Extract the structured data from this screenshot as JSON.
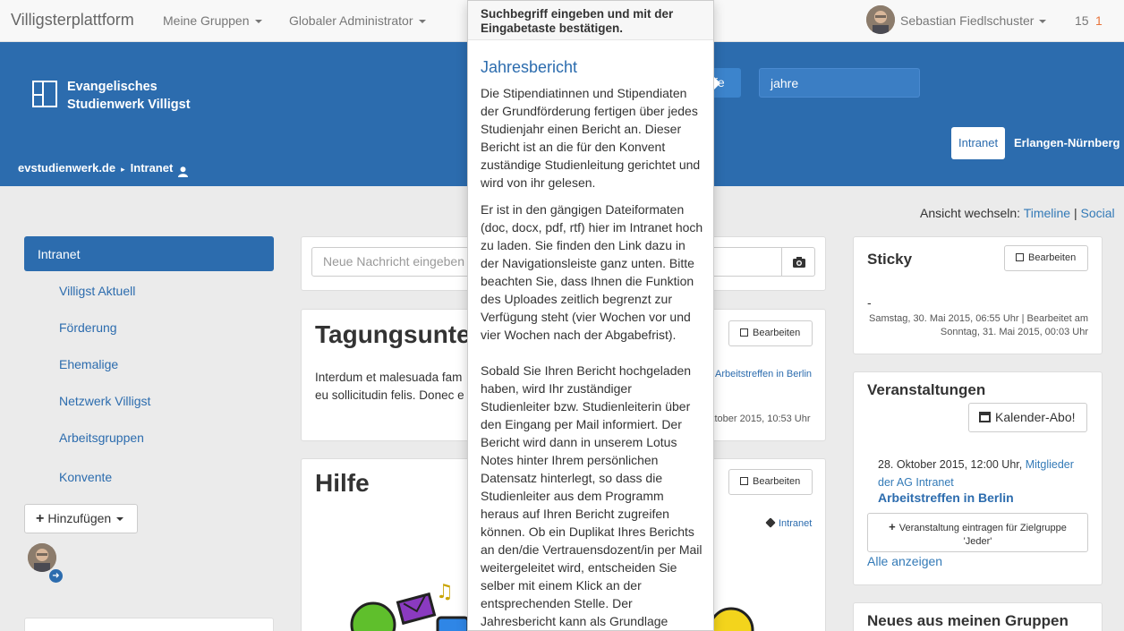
{
  "topnav": {
    "brand": "Villigsterplattform",
    "menu_groups": "Meine Gruppen",
    "menu_admin": "Globaler Administrator",
    "user_name": "Sebastian Fiedlschuster",
    "count_messages": "15",
    "count_notifications": "1"
  },
  "header": {
    "logo_text": "Evangelisches\nStudienwerk Villigst",
    "hilfe_label": "fe",
    "search_value": "jahre",
    "pill_intranet": "Intranet",
    "pill_erlangen": "Erlangen-Nürnberg",
    "breadcrumb_root": "evstudienwerk.de",
    "breadcrumb_current": "Intranet"
  },
  "switch_view": {
    "label": "Ansicht wechseln:",
    "timeline": "Timeline",
    "separator": "|",
    "social": "Social"
  },
  "sidebar": {
    "active": "Intranet",
    "items": [
      "Villigst Aktuell",
      "Förderung",
      "Ehemalige",
      "Netzwerk Villigst",
      "Arbeitsgruppen",
      "Konvente"
    ],
    "add_button": "Hinzufügen"
  },
  "main": {
    "new_message_placeholder": "Neue Nachricht eingeben",
    "posts": [
      {
        "title": "Tagungsunter",
        "edit": "Bearbeiten",
        "tag": "Arbeitstreffen in Berlin",
        "body_line1": "Interdum et malesuada fam",
        "body_line2": "eu sollicitudin felis. Donec e",
        "meta": "ktober 2015, 10:53 Uhr"
      },
      {
        "title": "Hilfe",
        "edit": "Bearbeiten",
        "tag": "Intranet"
      }
    ]
  },
  "popover": {
    "header": "Suchbegriff eingeben und mit der Eingabetaste bestätigen.",
    "title": "Jahresbericht",
    "para1": "Die Stipendiatinnen und Stipendiaten der Grundförderung fertigen über jedes Studienjahr einen Bericht an. Dieser Bericht ist an die für den Konvent zuständige Studienleitung gerichtet und wird von ihr gelesen.",
    "para2": "Er ist in den gängigen Dateiformaten (doc, docx, pdf, rtf) hier im Intranet hoch zu laden. Sie finden den Link dazu in der Navigationsleiste ganz unten. Bitte beachten Sie, dass Ihnen die Funktion des Uploades zeitlich begrenzt zur Verfügung steht (vier Wochen vor und vier Wochen nach der Abgabefrist).",
    "para3": "Sobald Sie Ihren Bericht hochgeladen haben, wird Ihr zuständiger Studienleiter bzw. Studienleiterin über den Eingang per Mail informiert. Der Bericht wird dann in unserem Lotus Notes hinter Ihrem persönlichen Datensatz hinterlegt, so dass die Studienleiter aus dem Programm heraus auf Ihren Bericht zugreifen können. Ob ein Duplikat Ihres Berichts an den/die Vertrauensdozent/in per Mail weitergeleitet wird, entscheiden Sie selber mit einem Klick an der entsprechenden Stelle. Der Jahresbericht kann als Grundlage"
  },
  "right": {
    "sticky": {
      "title": "Sticky",
      "edit": "Bearbeiten",
      "content": "-",
      "meta_line1": "Samstag, 30. Mai 2015, 06:55 Uhr | Bearbeitet am",
      "meta_line2": "Sonntag, 31. Mai 2015, 00:03 Uhr"
    },
    "events": {
      "title": "Veranstaltungen",
      "calendar_button": "Kalender-Abo!",
      "event_date": "28. Oktober 2015, 12:00 Uhr,",
      "event_group": "Mitglieder der AG Intranet",
      "event_title": "Arbeitstreffen in Berlin",
      "add_event_button": "Veranstaltung eintragen für Zielgruppe 'Jeder'",
      "show_all": "Alle anzeigen"
    },
    "news": {
      "title": "Neues aus meinen Gruppen"
    }
  },
  "colors": {
    "primary_blue": "#2c6cae",
    "link_blue": "#337ab7",
    "page_bg": "#ebebeb",
    "notification_orange": "#e8743b"
  }
}
